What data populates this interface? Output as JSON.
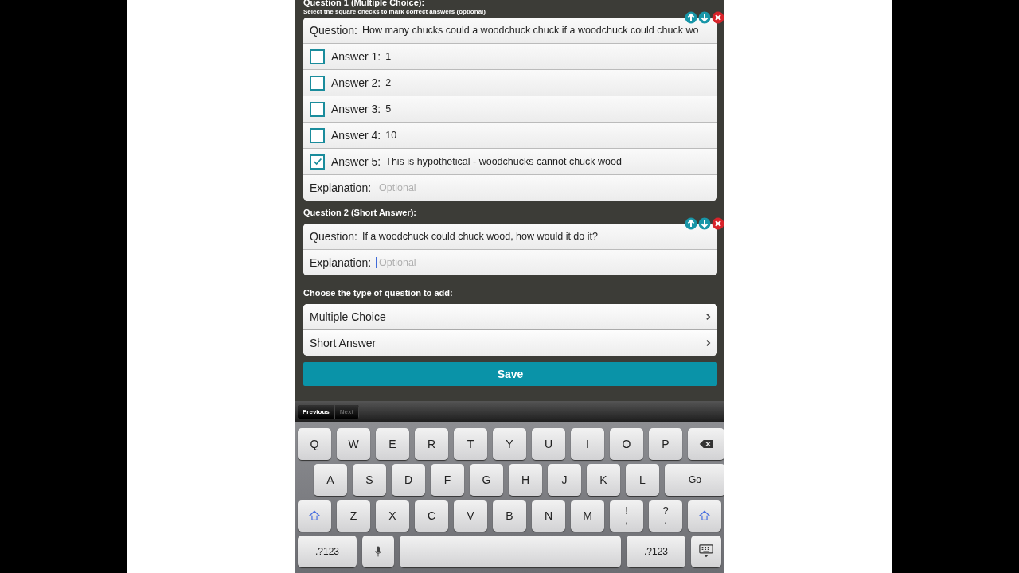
{
  "question_1": {
    "title": "Question 1 (Multiple Choice):",
    "hint": "Select the square checks to mark correct answers (optional)",
    "question": {
      "label": "Question:",
      "value": "How many chucks could a woodchuck chuck if a woodchuck could chuck wo"
    },
    "answers": [
      {
        "label": "Answer 1:",
        "value": "1",
        "checked": false
      },
      {
        "label": "Answer 2:",
        "value": "2",
        "checked": false
      },
      {
        "label": "Answer 3:",
        "value": "5",
        "checked": false
      },
      {
        "label": "Answer 4:",
        "value": "10",
        "checked": false
      },
      {
        "label": "Answer 5:",
        "value": "This is hypothetical - woodchucks cannot chuck wood",
        "checked": true
      }
    ],
    "explanation": {
      "label": "Explanation:",
      "placeholder": "Optional",
      "focused": false
    }
  },
  "question_2": {
    "title": "Question 2 (Short Answer):",
    "question": {
      "label": "Question:",
      "value": "If a woodchuck could chuck wood, how would it do it?"
    },
    "explanation": {
      "label": "Explanation:",
      "placeholder": "Optional",
      "focused": true
    }
  },
  "add_question": {
    "title": "Choose the type of question to add:",
    "options": [
      "Multiple Choice",
      "Short Answer"
    ]
  },
  "save_button": "Save",
  "form_nav": [
    {
      "label": "Previous",
      "disabled": false
    },
    {
      "label": "Next",
      "disabled": true
    }
  ],
  "keyboard": [
    [
      {
        "kind": "letter",
        "label": "Q"
      },
      {
        "kind": "letter",
        "label": "W"
      },
      {
        "kind": "letter",
        "label": "E"
      },
      {
        "kind": "letter",
        "label": "R"
      },
      {
        "kind": "letter",
        "label": "T"
      },
      {
        "kind": "letter",
        "label": "Y"
      },
      {
        "kind": "letter",
        "label": "U"
      },
      {
        "kind": "letter",
        "label": "I"
      },
      {
        "kind": "letter",
        "label": "O"
      },
      {
        "kind": "letter",
        "label": "P"
      },
      {
        "kind": "backspace"
      }
    ],
    [
      {
        "kind": "letter",
        "label": "A"
      },
      {
        "kind": "letter",
        "label": "S"
      },
      {
        "kind": "letter",
        "label": "D"
      },
      {
        "kind": "letter",
        "label": "F"
      },
      {
        "kind": "letter",
        "label": "G"
      },
      {
        "kind": "letter",
        "label": "H"
      },
      {
        "kind": "letter",
        "label": "J"
      },
      {
        "kind": "letter",
        "label": "K"
      },
      {
        "kind": "letter",
        "label": "L"
      },
      {
        "kind": "go",
        "label": "Go"
      }
    ],
    [
      {
        "kind": "shift"
      },
      {
        "kind": "letter",
        "label": "Z"
      },
      {
        "kind": "letter",
        "label": "X"
      },
      {
        "kind": "letter",
        "label": "C"
      },
      {
        "kind": "letter",
        "label": "V"
      },
      {
        "kind": "letter",
        "label": "B"
      },
      {
        "kind": "letter",
        "label": "N"
      },
      {
        "kind": "letter",
        "label": "M"
      },
      {
        "kind": "dual",
        "top": "!",
        "bottom": ","
      },
      {
        "kind": "dual",
        "top": "?",
        "bottom": "."
      },
      {
        "kind": "shift"
      }
    ],
    [
      {
        "kind": "numbers",
        "label": ".?123"
      },
      {
        "kind": "mic"
      },
      {
        "kind": "space"
      },
      {
        "kind": "numbers",
        "label": ".?123"
      },
      {
        "kind": "hide"
      }
    ]
  ]
}
